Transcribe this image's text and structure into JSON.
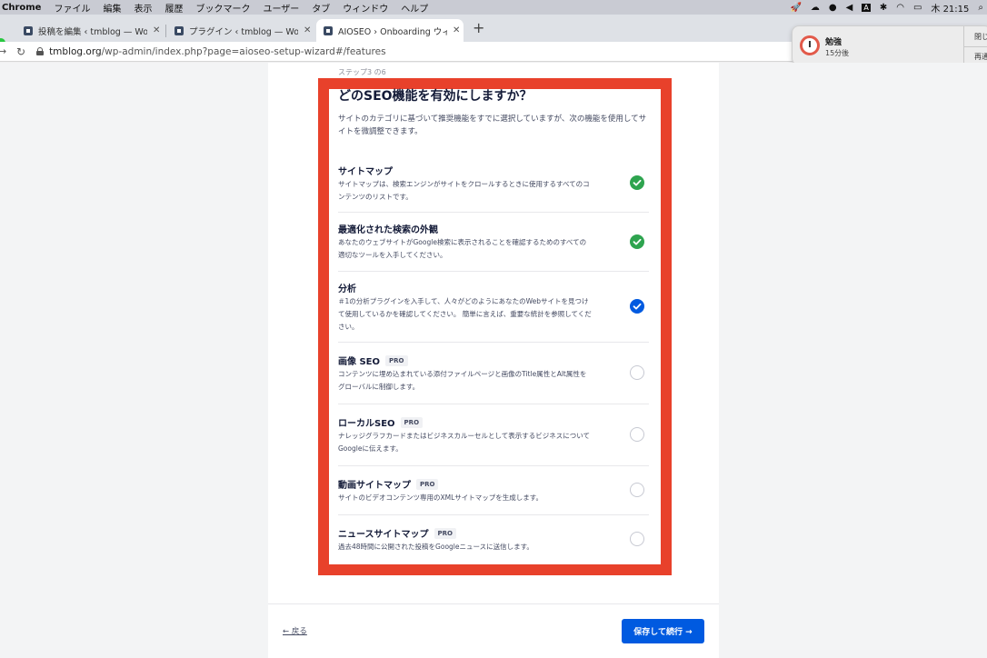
{
  "menubar": {
    "app": "Chrome",
    "items": [
      "ファイル",
      "編集",
      "表示",
      "履歴",
      "ブックマーク",
      "ユーザー",
      "タブ",
      "ウィンドウ",
      "ヘルプ"
    ],
    "input_indicator": "A",
    "clock": "木 21:15"
  },
  "tabs": [
    {
      "label": "投稿を編集 ‹ tmblog — WordPress",
      "close": "✕"
    },
    {
      "label": "プラグイン ‹ tmblog — WordPress",
      "close": "✕"
    },
    {
      "label": "AIOSEO › Onboarding ウィザード",
      "close": "✕"
    }
  ],
  "new_tab": "+",
  "address": {
    "domain": "tmblog.org",
    "path": "/wp-admin/index.php?page=aioseo-setup-wizard#/features"
  },
  "notification": {
    "title": "勉強",
    "subtitle": "15分後",
    "action1": "閉じ",
    "action2": "再通"
  },
  "wizard": {
    "step": "ステップ3 の6",
    "title": "どのSEO機能を有効にしますか？",
    "intro": "サイトのカテゴリに基づいて推奨機能をすでに選択していますが、次の機能を使用してサイトを微調整できます。",
    "pro_label": "PRO",
    "features": [
      {
        "title": "サイトマップ",
        "desc": "サイトマップは、検索エンジンがサイトをクロールするときに使用するすべてのコンテンツのリストです。",
        "checked": true,
        "style": "green"
      },
      {
        "title": "最適化された検索の外観",
        "desc": "あなたのウェブサイトがGoogle検索に表示されることを確認するためのすべての適切なツールを入手してください。",
        "checked": true,
        "style": "green"
      },
      {
        "title": "分析",
        "desc": "＃1の分析プラグインを入手して、人々がどのようにあなたのWebサイトを見つけて使用しているかを確認してください。 簡単に言えば、重要な統計を参照してください。",
        "checked": true,
        "style": "blue"
      },
      {
        "title": "画像 SEO",
        "desc": "コンテンツに埋め込まれている添付ファイルページと画像のTitle属性とAlt属性をグローバルに制御します。",
        "checked": false,
        "pro": true
      },
      {
        "title": "ローカルSEO",
        "desc": "ナレッジグラフカードまたはビジネスカルーセルとして表示するビジネスについてGoogleに伝えます。",
        "checked": false,
        "pro": true
      },
      {
        "title": "動画サイトマップ",
        "desc": "サイトのビデオコンテンツ専用のXMLサイトマップを生成します。",
        "checked": false,
        "pro": true
      },
      {
        "title": "ニュースサイトマップ",
        "desc": "過去48時間に公開された投稿をGoogleニュースに送信します。",
        "checked": false,
        "pro": true
      }
    ],
    "back": "← 戻る",
    "save": "保存して続行 →"
  },
  "colors": {
    "highlight_frame": "#e8412b",
    "check_green": "#2ea44f",
    "check_blue": "#005ae0",
    "primary_button": "#005ae0"
  }
}
